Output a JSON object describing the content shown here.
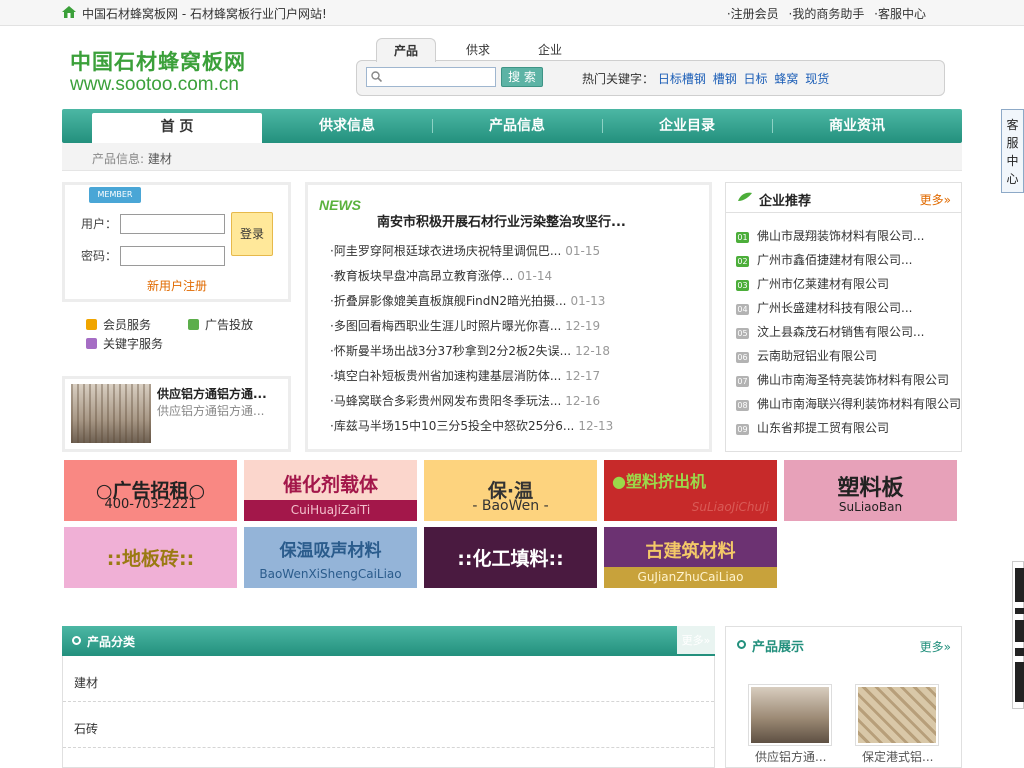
{
  "topbar": {
    "site_title": "中国石材蜂窝板网 - 石材蜂窝板行业门户网站!",
    "links": [
      "·注册会员",
      "·我的商务助手",
      "·客服中心"
    ]
  },
  "logo": {
    "cn": "中国石材蜂窝板网",
    "url": "www.sootoo.com.cn"
  },
  "search": {
    "tabs": [
      "产品",
      "供求",
      "企业"
    ],
    "active_tab": "产品",
    "placeholder": "",
    "button": "搜 索",
    "hot_label": "热门关键字：",
    "hot_keywords": [
      "日标槽钢",
      "槽钢",
      "日标",
      "蜂窝",
      "现货"
    ]
  },
  "nav": {
    "items": [
      "首 页",
      "供求信息",
      "产品信息",
      "企业目录",
      "商业资讯"
    ]
  },
  "breadcrumb": {
    "label": "产品信息:",
    "current": "建材"
  },
  "login": {
    "badge": "MEMBER",
    "user_label": "用户：",
    "pass_label": "密码：",
    "login_button": "登录",
    "register": "新用户注册"
  },
  "services": [
    "会员服务",
    "广告投放",
    "关键字服务"
  ],
  "supply": {
    "title": "供应铝方通铝方通...",
    "subtitle": "供应铝方通铝方通..."
  },
  "news": {
    "badge": "NEWS",
    "headline": "南安市积极开展石材行业污染整治攻坚行...",
    "items": [
      {
        "text": "·阿圭罗穿阿根廷球衣进场庆祝特里调侃巴...",
        "date": "01-15"
      },
      {
        "text": "·教育板块早盘冲高昂立教育涨停...",
        "date": "01-14"
      },
      {
        "text": "·折叠屏影像媲美直板旗舰FindN2暗光拍摄...",
        "date": "01-13"
      },
      {
        "text": "·多图回看梅西职业生涯儿时照片曝光你喜...",
        "date": "12-19"
      },
      {
        "text": "·怀斯曼半场出战3分37秒拿到2分2板2失误...",
        "date": "12-18"
      },
      {
        "text": "·填空白补短板贵州省加速构建基层消防体...",
        "date": "12-17"
      },
      {
        "text": "·马蜂窝联合多彩贵州网发布贵阳冬季玩法...",
        "date": "12-16"
      },
      {
        "text": "·库兹马半场15中10三分5投全中怒砍25分6...",
        "date": "12-13"
      }
    ]
  },
  "recommend": {
    "title": "企业推荐",
    "more": "更多»",
    "items": [
      {
        "num": "01",
        "name": "佛山市晟翔装饰材料有限公司..."
      },
      {
        "num": "02",
        "name": "广州市鑫佰捷建材有限公司..."
      },
      {
        "num": "03",
        "name": "广州市亿莱建材有限公司"
      },
      {
        "num": "04",
        "name": "广州长盛建材科技有限公司..."
      },
      {
        "num": "05",
        "name": "汶上县森茂石材销售有限公司..."
      },
      {
        "num": "06",
        "name": "云南助冠铝业有限公司"
      },
      {
        "num": "07",
        "name": "佛山市南海圣特亮装饰材料有限公司"
      },
      {
        "num": "08",
        "name": "佛山市南海联兴得利装饰材料有限公司"
      },
      {
        "num": "09",
        "name": "山东省邦提工贸有限公司"
      }
    ]
  },
  "banners": [
    {
      "big": "○广告招租○",
      "small": "400-703-2221"
    },
    {
      "big": "催化剂载体",
      "small": "CuiHuaJiZaiTi"
    },
    {
      "big": "保·温",
      "small": "- BaoWen -"
    },
    {
      "big": "●塑料挤出机",
      "small": "SuLiaoJiChuJi"
    },
    {
      "big": "塑料板",
      "small": "SuLiaoBan"
    },
    {
      "big": "::地板砖::",
      "small": ""
    },
    {
      "big": "保温吸声材料",
      "small": "BaoWenXiShengCaiLiao"
    },
    {
      "big": "::化工填料::",
      "small": ""
    },
    {
      "big": "古建筑材料",
      "small": "GuJianZhuCaiLiao"
    }
  ],
  "categories": {
    "title": "产品分类",
    "more": "更多»",
    "items": [
      "建材",
      "石砖"
    ]
  },
  "products": {
    "title": "产品展示",
    "more": "更多»",
    "items": [
      {
        "caption": "供应铝方通..."
      },
      {
        "caption": "保定港式铝..."
      }
    ]
  },
  "side_tab": {
    "label": [
      "客",
      "服",
      "中",
      "心"
    ]
  },
  "colors": {
    "brand_green": "#23907d",
    "logo_green": "#3ba03a",
    "link_blue": "#1d5fb7",
    "accent_orange": "#e06a00"
  }
}
